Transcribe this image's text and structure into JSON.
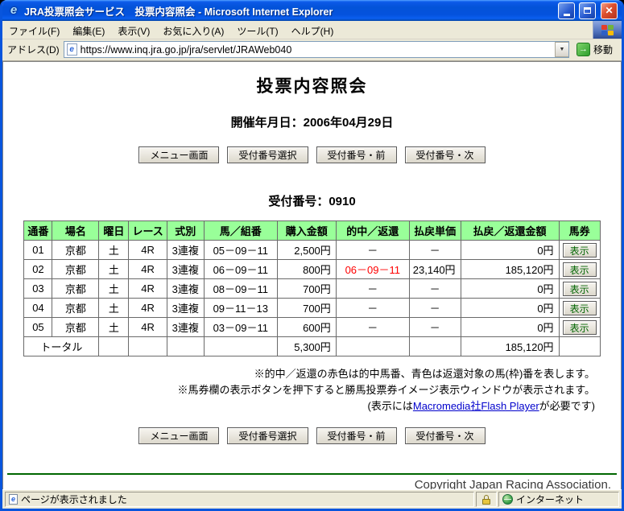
{
  "colors": {
    "titlebar_blue": "#0855dd",
    "table_header_green": "#99ff99",
    "hit_red": "#ff0000",
    "link_blue": "#0000cc",
    "hr_green": "#006600"
  },
  "window": {
    "title": "JRA投票照会サービス　投票内容照会 - Microsoft Internet Explorer"
  },
  "menubar": {
    "items": [
      "ファイル(F)",
      "編集(E)",
      "表示(V)",
      "お気に入り(A)",
      "ツール(T)",
      "ヘルプ(H)"
    ]
  },
  "addressbar": {
    "label": "アドレス(D)",
    "url": "https://www.inq.jra.go.jp/jra/servlet/JRAWeb040",
    "go_label": "移動"
  },
  "page": {
    "title": "投票内容照会",
    "date_line": "開催年月日：2006年04月29日",
    "receipt_number": "受付番号：0910",
    "nav_buttons": [
      "メニュー画面",
      "受付番号選択",
      "受付番号・前",
      "受付番号・次"
    ],
    "table": {
      "headers": [
        "通番",
        "場名",
        "曜日",
        "レース",
        "式別",
        "馬／組番",
        "購入金額",
        "的中／返還",
        "払戻単価",
        "払戻／返還金額",
        "馬券"
      ],
      "show_button_label": "表示",
      "rows": [
        {
          "cells": [
            "01",
            "京都",
            "土",
            "4R",
            "3連複",
            "05－09－11",
            "2,500円",
            "－",
            "－",
            "0円"
          ],
          "hit": false
        },
        {
          "cells": [
            "02",
            "京都",
            "土",
            "4R",
            "3連複",
            "06－09－11",
            "800円",
            "06－09－11",
            "23,140円",
            "185,120円"
          ],
          "hit": true
        },
        {
          "cells": [
            "03",
            "京都",
            "土",
            "4R",
            "3連複",
            "08－09－11",
            "700円",
            "－",
            "－",
            "0円"
          ],
          "hit": false
        },
        {
          "cells": [
            "04",
            "京都",
            "土",
            "4R",
            "3連複",
            "09－11－13",
            "700円",
            "－",
            "－",
            "0円"
          ],
          "hit": false
        },
        {
          "cells": [
            "05",
            "京都",
            "土",
            "4R",
            "3連複",
            "03－09－11",
            "600円",
            "－",
            "－",
            "0円"
          ],
          "hit": false
        }
      ],
      "total": {
        "label": "トータル",
        "amount": "5,300円",
        "payout": "185,120円"
      }
    },
    "notes": {
      "line1": "※的中／返還の赤色は的中馬番、青色は返還対象の馬(枠)番を表します。",
      "line2": "※馬券欄の表示ボタンを押下すると勝馬投票券イメージ表示ウィンドウが表示されます。",
      "line3_prefix": "(表示には",
      "line3_link": "Macromedia社Flash Player",
      "line3_suffix": "が必要です)"
    },
    "copyright": "Copyright Japan Racing Association."
  },
  "statusbar": {
    "text": "ページが表示されました",
    "zone": "インターネット"
  }
}
